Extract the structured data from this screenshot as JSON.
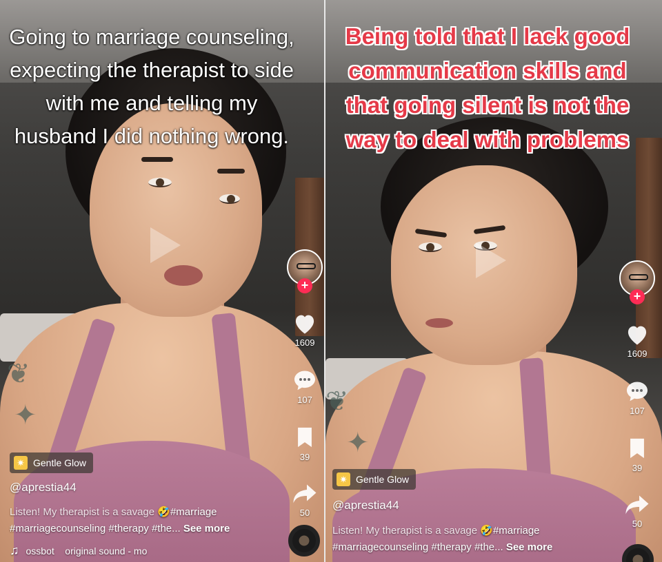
{
  "left": {
    "caption": "Going to marriage counseling, expecting the therapist to side with me and telling my husband I did nothing wrong.",
    "likes": "1609",
    "comments": "107",
    "saves": "39",
    "shares": "50",
    "effect": "Gentle Glow",
    "username": "@aprestia44",
    "description_line1": "Listen! My therapist is a savage",
    "emoji": "🤣",
    "hashtag1": "#marriage",
    "description_line2": "#marriagecounseling #therapy #the...",
    "see_more": "See more",
    "sound_text": "ossbot    original sound - mo"
  },
  "right": {
    "caption": "Being told that I lack good communication skills and that going silent is not the way to deal with problems",
    "likes": "1609",
    "comments": "107",
    "saves": "39",
    "shares": "50",
    "effect": "Gentle Glow",
    "username": "@aprestia44",
    "description_line1": "Listen! My therapist is a savage",
    "emoji": "🤣",
    "hashtag1": "#marriage",
    "description_line2": "#marriagecounseling #therapy #the...",
    "see_more": "See more"
  },
  "icons": [
    "heart-icon",
    "comment-icon",
    "bookmark-icon",
    "share-icon",
    "music-note-icon",
    "sparkle-icon",
    "follow-plus-icon"
  ],
  "colors": {
    "follow_red": "#fe2c55",
    "caption_red": "#e53a48",
    "effect_yellow": "#f6c646",
    "shirt_pink": "#b27792"
  }
}
